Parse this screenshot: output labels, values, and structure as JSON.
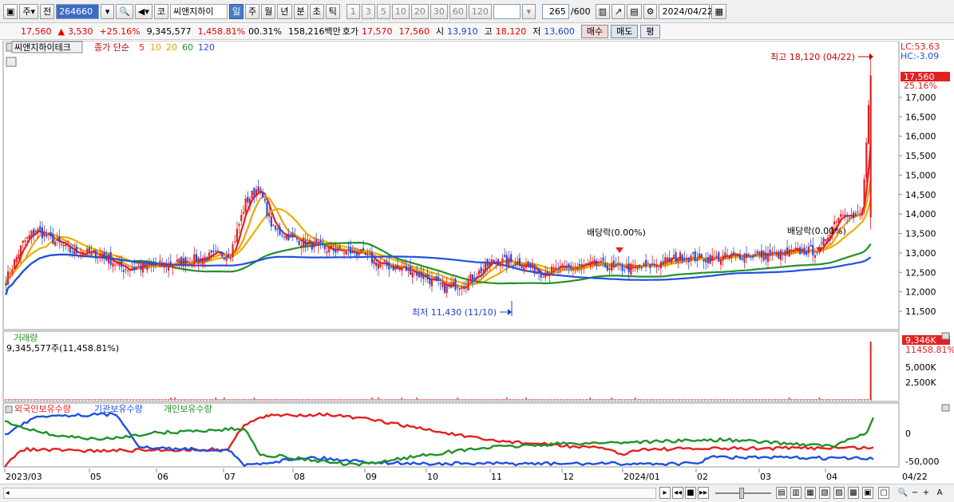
{
  "toolbar": {
    "market_label": "주",
    "prev_label": "전",
    "stock_code": "264660",
    "kospi_label": "코",
    "stock_name": "씨앤지하이",
    "periods": [
      "일",
      "주",
      "월",
      "년",
      "분",
      "초",
      "틱"
    ],
    "active_period": "일",
    "intervals": [
      "1",
      "3",
      "5",
      "10",
      "20",
      "30",
      "60",
      "120"
    ],
    "count_display": "265",
    "count_max": "/600",
    "date": "2024/04/22"
  },
  "quote": {
    "price": "17,560",
    "change_arrow": "▲",
    "change": "3,530",
    "change_pct": "+25.16%",
    "volume": "9,345,577",
    "volume_pct": "1,458.81%",
    "turnover": "00.31%",
    "amount": "158,216백만",
    "ask_label": "호가",
    "ask": "17,570",
    "bid": "17,560",
    "open_label": "시",
    "open": "13,910",
    "high_label": "고",
    "high": "18,120",
    "low_label": "저",
    "low": "13,600",
    "buy_label": "매수",
    "sell_label": "매도",
    "avg_label": "평"
  },
  "price_panel": {
    "name_tag": "씨앤지하이테크",
    "ma_prefix": "종가 단순",
    "ma_periods": [
      "5",
      "10",
      "20",
      "60",
      "120"
    ],
    "ma_colors": [
      "#e32020",
      "#f0a010",
      "#e8b000",
      "#20922a",
      "#2050e0"
    ],
    "lc_label": "LC:53.63",
    "hc_label": "HC:-3.09",
    "last_price_tag": "17,560",
    "last_pct_tag": "25.16%",
    "y_ticks": [
      "17,000",
      "16,500",
      "16,000",
      "15,500",
      "15,000",
      "14,500",
      "14,000",
      "13,500",
      "13,000",
      "12,500",
      "12,000",
      "11,500"
    ],
    "annotation_high": "최고 18,120 (04/22)",
    "annotation_low": "최저 11,430 (11/10)",
    "dividend_1": "배당락(0.00%)",
    "dividend_2": "배당락(0.00%)"
  },
  "volume_panel": {
    "title": "거래량",
    "value_label": "9,345,577주(11,458.81%)",
    "tag_value": "9,346K",
    "tag_pct": "11458.81%",
    "y_ticks": [
      "5,000K",
      "2,500K"
    ]
  },
  "holding_panel": {
    "series": [
      {
        "name": "외국인보유수량",
        "color": "#e32020"
      },
      {
        "name": "기관보유수량",
        "color": "#2050e0"
      },
      {
        "name": "개인보유수량",
        "color": "#20922a"
      }
    ],
    "y_ticks": [
      "0",
      "-50,000"
    ]
  },
  "x_axis": {
    "labels": [
      "2023/03",
      "05",
      "06",
      "07",
      "08",
      "09",
      "10",
      "11",
      "12",
      "2024/01",
      "02",
      "03",
      "04"
    ],
    "right_label": "04/22"
  }
}
